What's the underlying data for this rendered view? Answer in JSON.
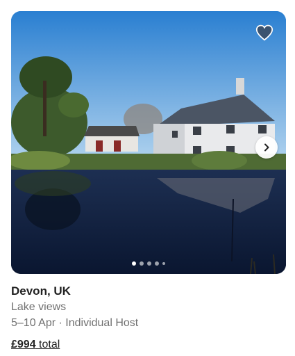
{
  "listing": {
    "location": "Devon, UK",
    "description": "Lake views",
    "dates": "5–10 Apr · Individual Host",
    "price_amount": "£994",
    "price_suffix": " total"
  },
  "carousel": {
    "image_count": 5,
    "active_index": 0
  },
  "icons": {
    "favorite": "heart-icon",
    "next": "chevron-right-icon"
  },
  "colors": {
    "heart_fill": "#3c4a5e",
    "text_primary": "#222222",
    "text_secondary": "#717171"
  }
}
